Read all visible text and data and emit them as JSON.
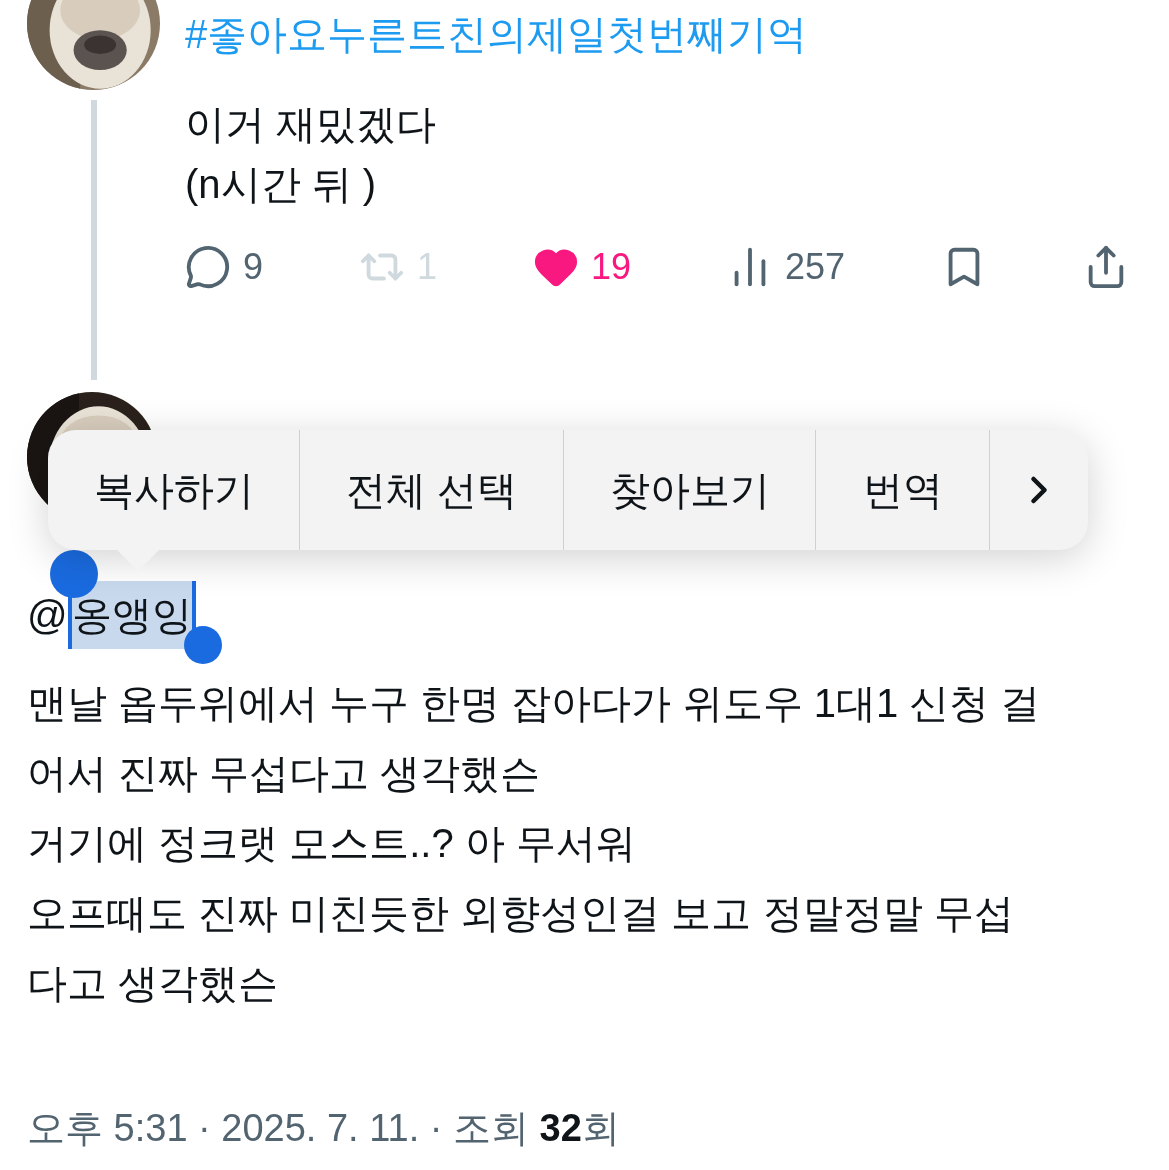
{
  "parent_tweet": {
    "hashtag": "#좋아요누른트친의제일첫번째기억",
    "text": "이거 재밌겠다\n(n시간 뒤 )",
    "actions": [
      {
        "kind": "reply",
        "count": "9",
        "active": false,
        "disabled": false
      },
      {
        "kind": "retweet",
        "count": "1",
        "active": false,
        "disabled": true
      },
      {
        "kind": "like",
        "count": "19",
        "active": true,
        "disabled": false
      },
      {
        "kind": "views",
        "count": "257",
        "active": false,
        "disabled": false
      },
      {
        "kind": "bookmark",
        "active": false,
        "disabled": false
      },
      {
        "kind": "share",
        "active": false,
        "disabled": false
      }
    ]
  },
  "tweet": {
    "mention": {
      "at": "@",
      "name": "옹앵잉",
      "selected": true
    },
    "body": "맨날 옵두위에서 누구 한명 잡아다가 위도우 1대1 신청 걸\n어서 진짜 무섭다고 생각했슨\n거기에 정크랫 모스트..? 아 무서워\n오프때도 진짜 미친듯한 외향성인걸 보고 정말정말 무섭\n다고 생각했슨",
    "meta": "오후 5:31 · 2025. 7. 11. · 조회 ",
    "views": "32",
    "views_suffix": "회"
  },
  "context_menu": {
    "items": [
      {
        "kind": "text",
        "label": "복사하기"
      },
      {
        "kind": "text",
        "label": "전체 선택"
      },
      {
        "kind": "text",
        "label": "찾아보기"
      },
      {
        "kind": "text",
        "label": "번역"
      },
      {
        "kind": "more"
      }
    ]
  }
}
